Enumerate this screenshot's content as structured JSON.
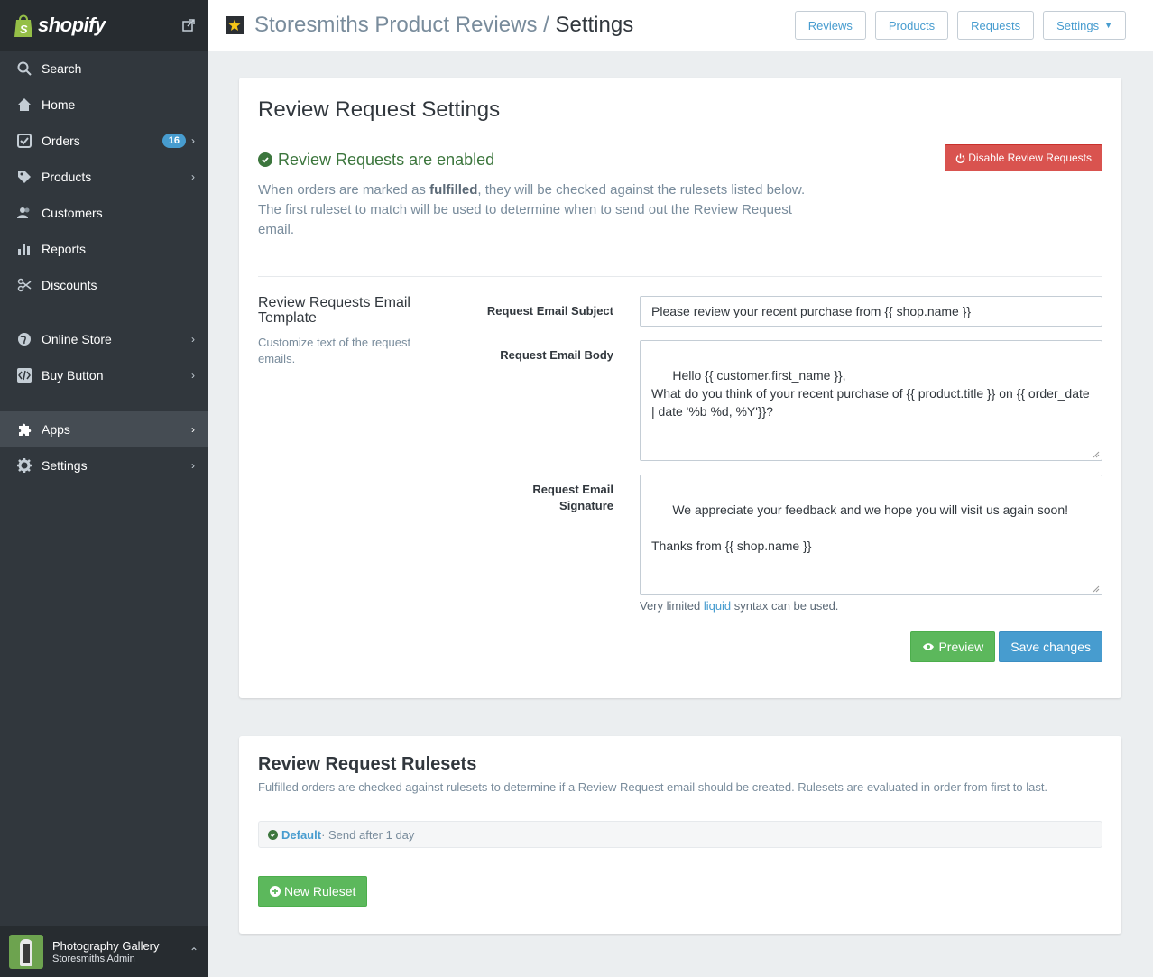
{
  "sidebar": {
    "brand": "shopify",
    "items": [
      {
        "label": "Search",
        "icon": "search-icon"
      },
      {
        "label": "Home",
        "icon": "home-icon"
      },
      {
        "label": "Orders",
        "icon": "orders-icon",
        "badge": "16"
      },
      {
        "label": "Products",
        "icon": "tag-icon"
      },
      {
        "label": "Customers",
        "icon": "customers-icon"
      },
      {
        "label": "Reports",
        "icon": "bar-chart-icon"
      },
      {
        "label": "Discounts",
        "icon": "discount-icon"
      },
      {
        "label": "Online Store",
        "icon": "globe-icon"
      },
      {
        "label": "Buy Button",
        "icon": "code-icon"
      },
      {
        "label": "Apps",
        "icon": "puzzle-icon"
      },
      {
        "label": "Settings",
        "icon": "gear-icon"
      }
    ],
    "store": {
      "name": "Photography Gallery",
      "sub": "Storesmiths Admin"
    }
  },
  "header": {
    "app_name": "Storesmiths Product Reviews",
    "separator": " / ",
    "current": "Settings",
    "buttons": {
      "reviews": "Reviews",
      "products": "Products",
      "requests": "Requests",
      "settings": "Settings"
    }
  },
  "settings_card": {
    "title": "Review Request Settings",
    "status": "Review Requests are enabled",
    "disable_button": "Disable Review Requests",
    "desc_before": "When orders are marked as ",
    "desc_bold": "fulfilled",
    "desc_after": ", they will be checked against the rulesets listed below. The first ruleset to match will be used to determine when to send out the Review Request email.",
    "template_title": "Review Requests Email Template",
    "template_sub": "Customize text of the request emails.",
    "subject_label": "Request Email Subject",
    "subject_value": "Please review your recent purchase from {{ shop.name }}",
    "body_label": "Request Email Body",
    "body_value": "Hello {{ customer.first_name }},\nWhat do you think of your recent purchase of {{ product.title }} on {{ order_date | date '%b %d, %Y'}}?",
    "signature_label_1": "Request Email",
    "signature_label_2": "Signature",
    "signature_value": "We appreciate your feedback and we hope you will visit us again soon!\n\nThanks from {{ shop.name }}",
    "hint_before": "Very limited ",
    "hint_link": "liquid",
    "hint_after": " syntax can be used.",
    "preview_button": "Preview",
    "save_button": "Save changes"
  },
  "rulesets_card": {
    "title": "Review Request Rulesets",
    "desc": "Fulfilled orders are checked against rulesets to determine if a Review Request email should be created. Rulesets are evaluated in order from first to last.",
    "rulesets": [
      {
        "name": "Default",
        "detail": " · Send after 1 day"
      }
    ],
    "new_button": "New Ruleset"
  },
  "colors": {
    "sidebar": "#31373d",
    "link": "#479ccf",
    "success": "#5cb85c",
    "danger": "#d9534f",
    "enabled": "#3c763d"
  }
}
